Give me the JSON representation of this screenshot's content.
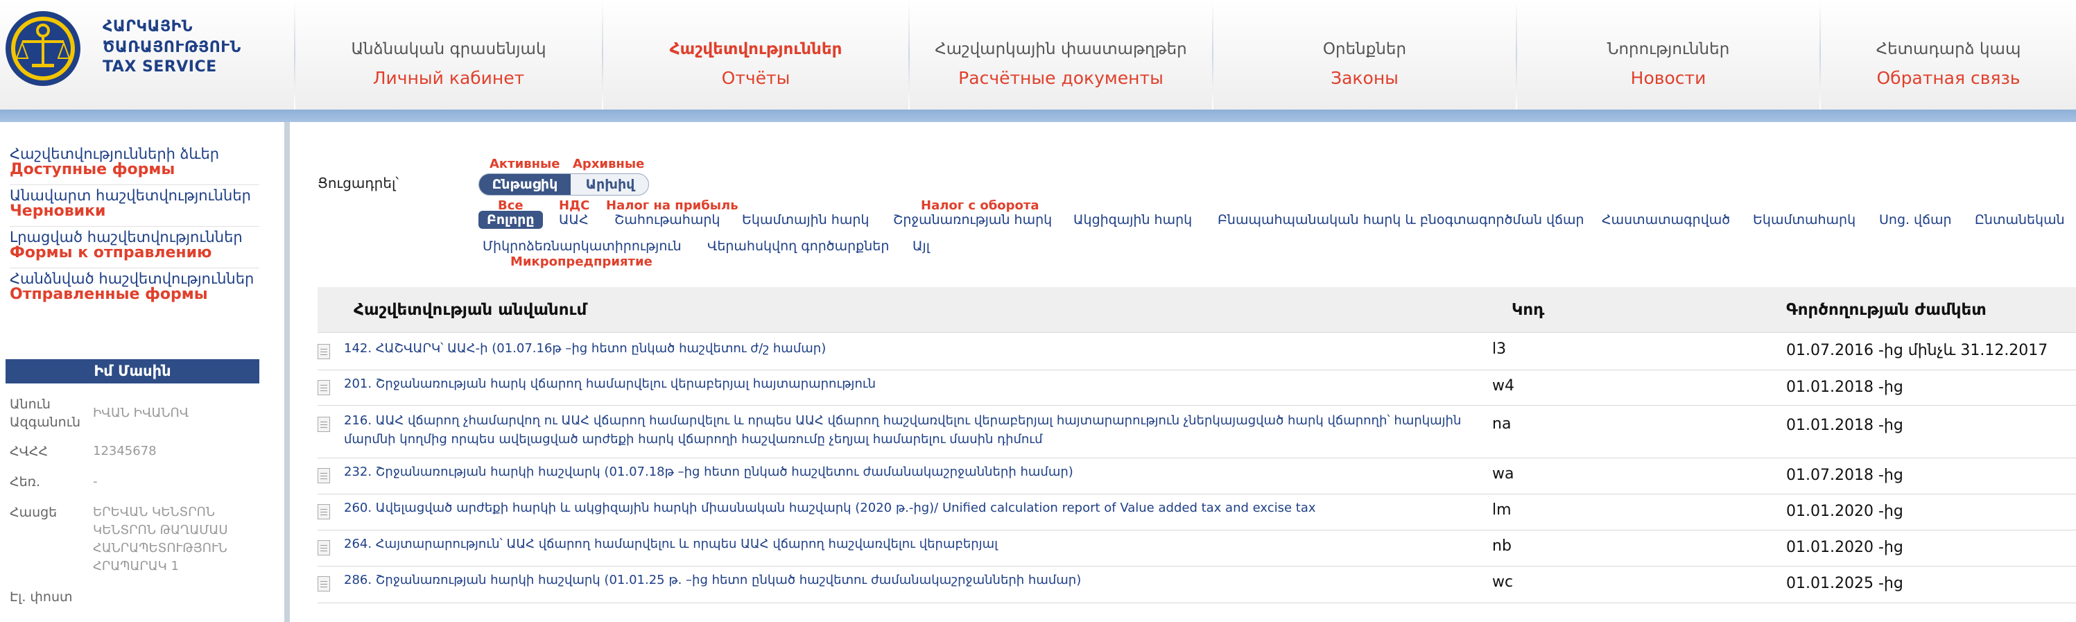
{
  "header": {
    "logo_line1": "ՀԱՐԿԱՅԻՆ",
    "logo_line2": "ԾԱՌԱՅՈՒԹՅՈՒՆ",
    "logo_line3": "TAX SERVICE",
    "nav": [
      {
        "hy": "Անձնական գրասենյակ",
        "ru": "Личный кабинет"
      },
      {
        "hy": "Հաշվետվություններ",
        "ru": "Отчёты"
      },
      {
        "hy": "Հաշվարկային փաստաթղթեր",
        "ru": "Расчётные документы"
      },
      {
        "hy": "Օրենքներ",
        "ru": "Законы"
      },
      {
        "hy": "Նորություններ",
        "ru": "Новости"
      },
      {
        "hy": "Հետադարձ կապ",
        "ru": "Обратная связь"
      }
    ]
  },
  "sidebar": {
    "links": [
      {
        "hy": "Հաշվետվությունների ձևեր",
        "ru": "Доступные формы"
      },
      {
        "hy": "Անավարտ հաշվետվություններ",
        "ru": "Черновики"
      },
      {
        "hy": "Լրացված հաշվետվություններ",
        "ru": "Формы к отправлению"
      },
      {
        "hy": "Հանձնված հաշվետվություններ",
        "ru": "Отправленные формы"
      }
    ],
    "profile": {
      "title": "Իմ Մասին",
      "fields": [
        {
          "label": "Անուն Ազգանուն",
          "label1": "Անուն",
          "label2": "Ազգանուն",
          "value": "ԻՎԱՆ ԻՎԱՆՈՎ"
        },
        {
          "label": "ՀՎՀՀ",
          "value": "12345678"
        },
        {
          "label": "Հեռ.",
          "value": "-"
        },
        {
          "label": "Հասցե",
          "value_lines": [
            "ԵՐԵՎԱՆ ԿԵՆՏՐՈՆ",
            "ԿԵՆՏՐՈՆ ԹԱՂԱՄԱՍ",
            "ՀԱՆՐԱՊԵՏՈՒԹՅՈՒՆ",
            "ՀՐԱՊԱՐԱԿ 1"
          ]
        },
        {
          "label": "Էլ. փոստ"
        }
      ]
    }
  },
  "filters": {
    "show_label": "Ցուցադրել՝",
    "toggle": {
      "active_ru": "Активные",
      "archive_ru": "Архивные",
      "current": "Ընթացիկ",
      "archive": "Արխիվ",
      "selected": "current"
    },
    "tax_tabs_row1": [
      {
        "label": "Բոլորը",
        "ru": "Все",
        "active": true
      },
      {
        "label": "ԱԱՀ",
        "ru": "НДС"
      },
      {
        "label": "Շահութահարկ",
        "ru": "Налог на прибыль"
      },
      {
        "label": "Եկամտային հարկ"
      },
      {
        "label": "Շրջանառության հարկ",
        "ru": "Налог с оборота"
      },
      {
        "label": "Ակցիզային հարկ"
      },
      {
        "label": "Բնապահպանական հարկ և բնօգտագործման վճար"
      },
      {
        "label": "Հաստատագրված"
      },
      {
        "label": "Եկամտահարկ"
      },
      {
        "label": "Սոց. վճար"
      },
      {
        "label": "Ընտանեկան"
      }
    ],
    "tax_tabs_row2": [
      {
        "label": "Միկրոձեռնարկատիրություն",
        "ru": "Микропредприятие"
      },
      {
        "label": "Վերահսկվող գործարքներ"
      },
      {
        "label": "Այլ"
      }
    ]
  },
  "table": {
    "columns": [
      "Հաշվետվության անվանում",
      "Կոդ",
      "Գործողության ժամկետ"
    ],
    "rows": [
      {
        "name": "142. ՀԱՇՎԱՐԿ՝ ԱԱՀ-ի (01.07.16թ –ից հետո ընկած հաշվետու ժ/շ համար)",
        "code": "l3",
        "period": "01.07.2016 -ից մինչև 31.12.2017"
      },
      {
        "name": "201. Շրջանառության հարկ վճարող համարվելու վերաբերյալ հայտարարություն",
        "code": "w4",
        "period": "01.01.2018 -ից"
      },
      {
        "name_lines": [
          "216. ԱԱՀ վճարող չհամարվող ու ԱԱՀ վճարող համարվելու և որպես ԱԱՀ վճարող հաշվառվելու վերաբերյալ հայտարարություն չներկայացված հարկ վճարողի՝ հարկային",
          "մարմնի կողմից որպես ավելացված արժեքի հարկ վճարողի հաշվառումը չեղյալ համարելու մասին դիմում"
        ],
        "code": "na",
        "period": "01.01.2018 -ից"
      },
      {
        "name": "232. Շրջանառության հարկի հաշվարկ (01.07.18թ –ից հետո ընկած հաշվետու ժամանակաշրջանների համար)",
        "code": "wa",
        "period": "01.07.2018 -ից"
      },
      {
        "name": "260. Ավելացված արժեքի հարկի և ակցիզային հարկի միասնական հաշվարկ (2020 թ.-ից)/ Unified calculation report of Value added tax and excise tax",
        "code": "lm",
        "period": "01.01.2020 -ից"
      },
      {
        "name": "264. Հայտարարություն՝ ԱԱՀ վճարող համարվելու և որպես ԱԱՀ վճարող հաշվառվելու վերաբերյալ",
        "code": "nb",
        "period": "01.01.2020 -ից"
      },
      {
        "name": "286. Շրջանառության հարկի հաշվարկ (01.01.25 թ. –ից հետո ընկած հաշվետու ժամանակաշրջանների համար)",
        "code": "wc",
        "period": "01.01.2025 -ից"
      }
    ]
  }
}
